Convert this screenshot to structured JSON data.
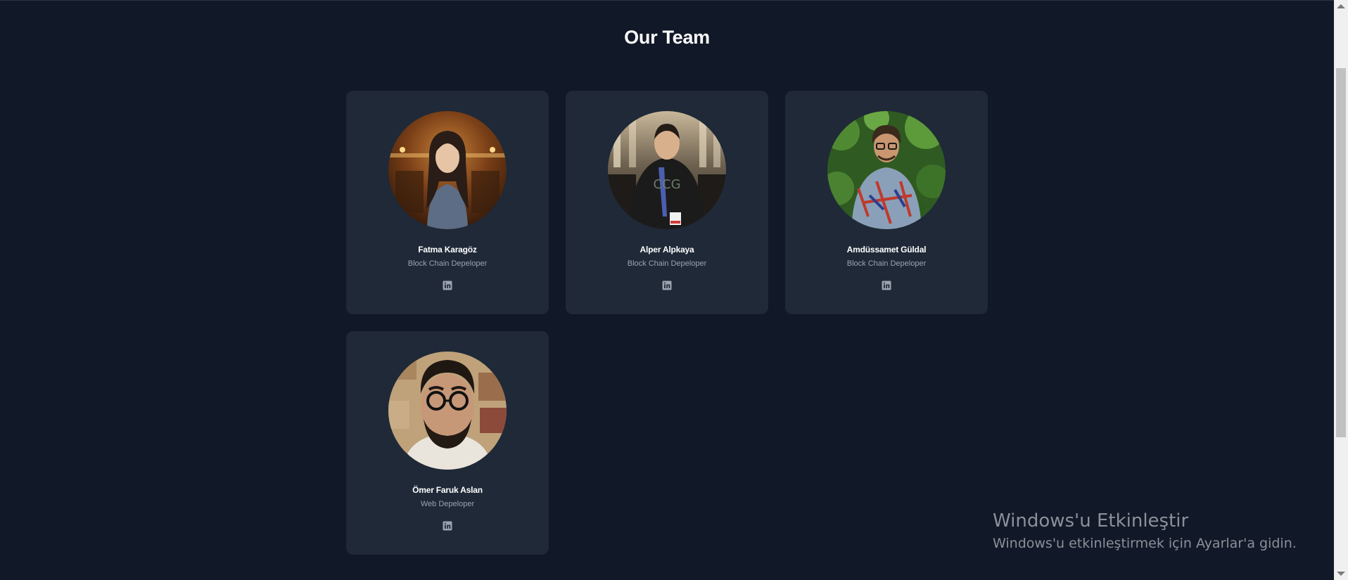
{
  "page": {
    "title": "Our Team"
  },
  "members": [
    {
      "name": "Fatma Karagöz",
      "role": "Block Chain Depeloper",
      "social_icon": "linkedin-icon"
    },
    {
      "name": "Alper Alpkaya",
      "role": "Block Chain Depeloper",
      "social_icon": "linkedin-icon"
    },
    {
      "name": "Amdüssamet Güldal",
      "role": "Block Chain Depeloper",
      "social_icon": "linkedin-icon"
    },
    {
      "name": "Ömer Faruk Aslan",
      "role": "Web Depeloper",
      "social_icon": "linkedin-icon"
    }
  ],
  "watermark": {
    "title": "Windows'u Etkinleştir",
    "subtitle": "Windows'u etkinleştirmek için Ayarlar'a gidin."
  },
  "colors": {
    "background": "#111827",
    "card": "#1f2937",
    "name_text": "#ffffff",
    "role_text": "#9ca3af",
    "icon": "#9ca3af"
  }
}
